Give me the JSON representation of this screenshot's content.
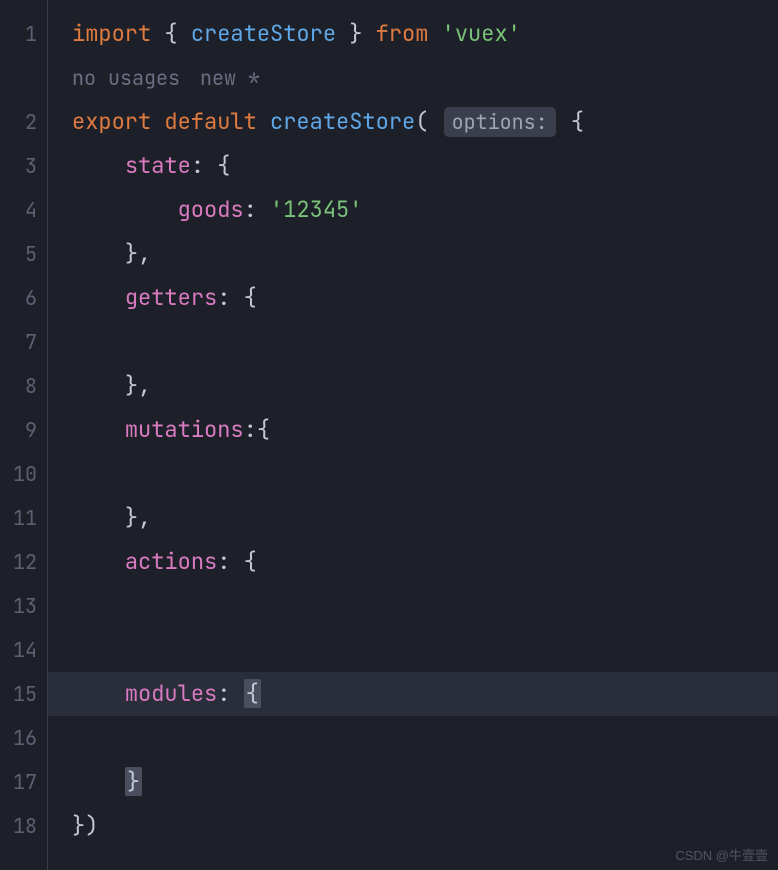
{
  "gutter": {
    "lines": [
      "1",
      "",
      "2",
      "3",
      "4",
      "5",
      "6",
      "7",
      "8",
      "9",
      "10",
      "11",
      "12",
      "13",
      "14",
      "15",
      "16",
      "17",
      "18"
    ]
  },
  "annotations": {
    "usages": "no usages",
    "vcs": "new *"
  },
  "hint": {
    "options": "options:"
  },
  "code": {
    "import_kw": "import",
    "lbrace": "{",
    "rbrace": "}",
    "createStore": "createStore",
    "from_kw": "from",
    "vuex_str": "'vuex'",
    "export_kw": "export",
    "default_kw": "default",
    "lparen": "(",
    "rparen": ")",
    "state": "state",
    "goods": "goods",
    "goods_val": "'12345'",
    "getters": "getters",
    "mutations": "mutations",
    "actions": "actions",
    "modules": "modules",
    "colon": ":",
    "comma": ",",
    "close_brace_comma": "},",
    "close_paren": "})"
  },
  "watermark": "CSDN @牛壹壹"
}
